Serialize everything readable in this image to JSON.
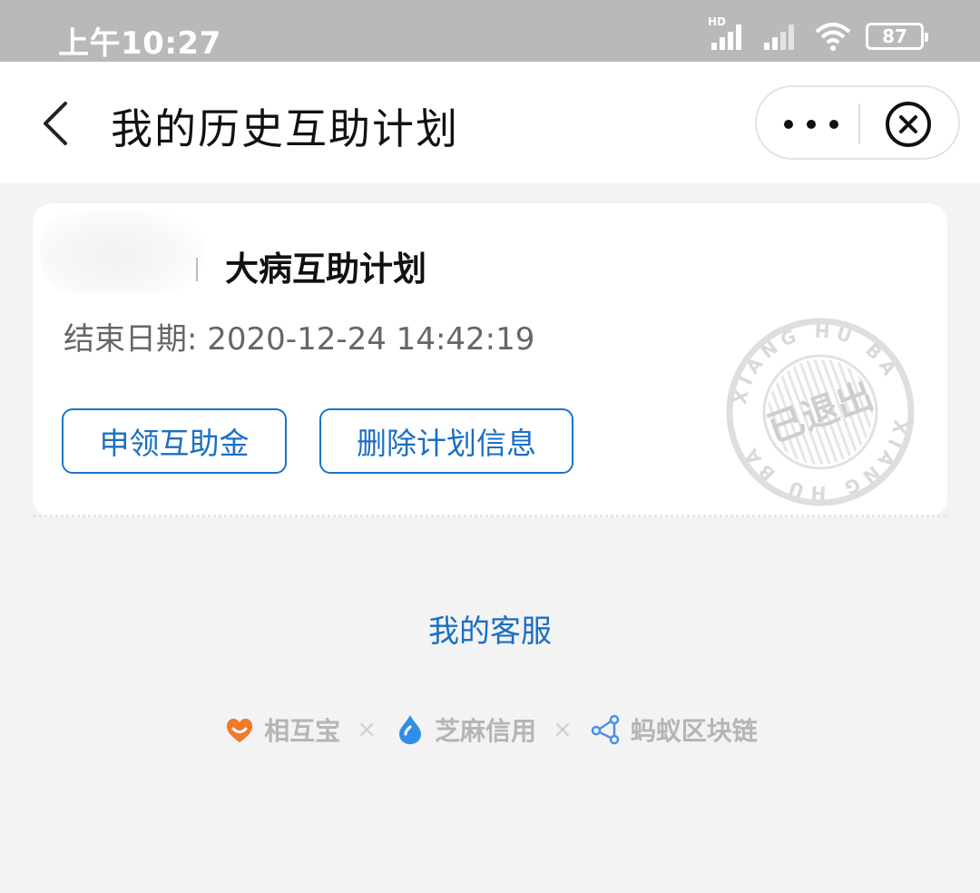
{
  "status_bar": {
    "time": "上午10:27",
    "hd_label": "HD",
    "battery": "87"
  },
  "nav": {
    "title": "我的历史互助计划"
  },
  "card": {
    "plan_name": "大病互助计划",
    "end_date_label": "结束日期:",
    "end_date_value": "2020-12-24 14:42:19",
    "claim_button": "申领互助金",
    "delete_button": "删除计划信息",
    "stamp_text": "已退出",
    "stamp_ring_text": "XIANG HU BAO"
  },
  "service_link": "我的客服",
  "footer": {
    "brands": [
      {
        "name": "相互宝",
        "icon": "xianghubao-logo-icon"
      },
      {
        "name": "芝麻信用",
        "icon": "zhima-credit-logo-icon"
      },
      {
        "name": "蚂蚁区块链",
        "icon": "ant-blockchain-logo-icon"
      }
    ],
    "separator": "×"
  },
  "colors": {
    "accent": "#1a6fc2",
    "status_bar": "#b9b9b9",
    "background": "#f3f3f3"
  }
}
